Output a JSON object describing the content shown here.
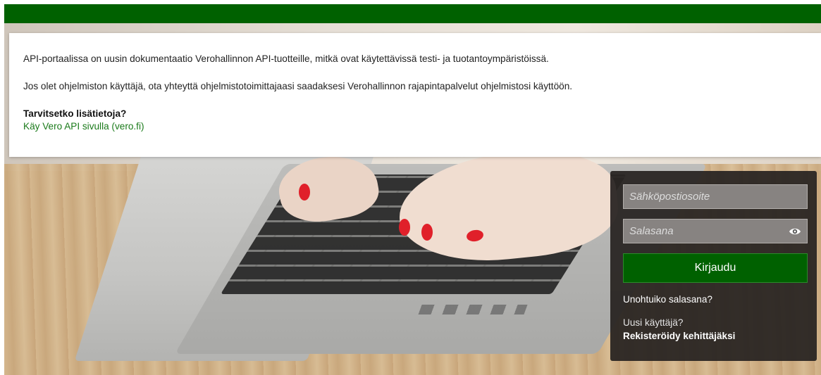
{
  "info": {
    "paragraph1": "API-portaalissa on uusin dokumentaatio Verohallinnon API-tuotteille, mitkä ovat käytettävissä testi- ja tuotantoympäristöissä.",
    "paragraph2": "Jos olet ohjelmiston käyttäjä, ota yhteyttä ohjelmistotoimittajaasi saadaksesi Verohallinnon rajapintapalvelut ohjelmistosi käyttöön.",
    "question": "Tarvitsetko lisätietoja?",
    "link_label": "Käy Vero API sivulla (vero.fi)"
  },
  "login": {
    "email_placeholder": "Sähköpostiosoite",
    "email_value": "",
    "password_placeholder": "Salasana",
    "password_value": "",
    "show_password_icon": "eye-icon",
    "submit_label": "Kirjaudu",
    "forgot_label": "Unohtuiko salasana?",
    "new_user_label": "Uusi käyttäjä?",
    "register_label": "Rekisteröidy kehittäjäksi"
  },
  "colors": {
    "brand_green": "#006100",
    "link_green": "#1a7a1a",
    "panel_dark": "#282422"
  }
}
